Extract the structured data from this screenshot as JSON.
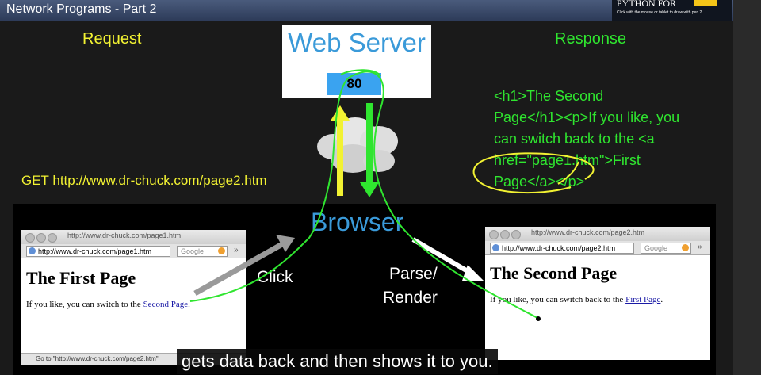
{
  "header": {
    "title": "Network Programs - Part 2"
  },
  "brand": {
    "line1": "PYTHON FOR",
    "line2": "Click with the mouse or tablet to draw with pen 2"
  },
  "labels": {
    "request": "Request",
    "response": "Response"
  },
  "server": {
    "name": "Web Server",
    "port": "80"
  },
  "get_line": "GET http://www.dr-chuck.com/page2.htm",
  "browser_label": "Browser",
  "response_code": [
    "<h1>The Second",
    "Page</h1><p>If you like, you",
    "can switch back to the <a",
    "href=\"page1.htm\">First",
    "Page</a></p>"
  ],
  "actions": {
    "click": "Click",
    "parse": "Parse/",
    "render": "Render"
  },
  "page1": {
    "window_title": "http://www.dr-chuck.com/page1.htm",
    "url": "http://www.dr-chuck.com/page1.htm",
    "search_placeholder": "Google",
    "heading": "The First Page",
    "text": "If you like, you can switch to the",
    "link": "Second Page",
    "after_link": ".",
    "status": "Go to \"http://www.dr-chuck.com/page2.htm\""
  },
  "page2": {
    "window_title": "http://www.dr-chuck.com/page2.htm",
    "url": "http://www.dr-chuck.com/page2.htm",
    "search_placeholder": "Google",
    "heading": "The Second Page",
    "text": "If you like, you can switch back to the",
    "link": "First Page",
    "after_link": "."
  },
  "caption": "gets data back and then shows it to you.",
  "colors": {
    "yellow": "#f2f232",
    "green": "#2fe52f",
    "blue": "#3a9ad9",
    "port_bg": "#3aa3f0"
  }
}
